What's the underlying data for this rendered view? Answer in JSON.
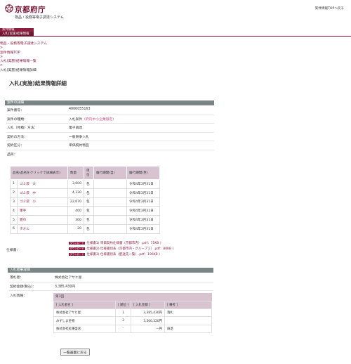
{
  "header": {
    "logo_text": "京都府庁",
    "subtitle": "物品・役務等電子調達システム",
    "back_to_top": "案件情報TOPへ戻る"
  },
  "menu": {
    "tabs": [
      "案件情報",
      "入札(実施)結果情報"
    ]
  },
  "breadcrumb": {
    "items": [
      "物品・役務等電子調達システム",
      "案件情報TOP",
      "入札(実施)結果情報一覧"
    ],
    "separator": ">",
    "current": "入札(実施)結果情報詳細"
  },
  "page_title": "入札(実施)結果情報詳細",
  "case": {
    "section_title": "案件の詳細",
    "rows": [
      {
        "label": "案件番号：",
        "value": "4000055163"
      },
      {
        "label": "案件の種類：",
        "value": "入札案件",
        "note": "(府内中小企業限定)"
      },
      {
        "label": "入札（見積）方法：",
        "value": "電子調達"
      },
      {
        "label": "契約の方法：",
        "value": "一般競争入札"
      },
      {
        "label": "契約区分：",
        "value": "単価契約物品"
      },
      {
        "label": "品目：",
        "value": ""
      }
    ]
  },
  "items_table": {
    "headers": [
      "品名(品名をクリックで詳細表示)",
      "数量",
      "単位",
      "履行期間(自)",
      "履行期間(至)"
    ],
    "rows": [
      {
        "no": "1",
        "name": "ゴミ袋　大",
        "qty": "3,600",
        "unit": "包",
        "from": "",
        "to": "令和4年3月31日"
      },
      {
        "no": "2",
        "name": "ゴミ袋　中",
        "qty": "4,330",
        "unit": "包",
        "from": "",
        "to": "令和4年3月31日"
      },
      {
        "no": "3",
        "name": "ゴミ袋　小",
        "qty": "22,670",
        "unit": "包",
        "from": "",
        "to": "令和4年3月31日"
      },
      {
        "no": "4",
        "name": "軍手",
        "qty": "400",
        "unit": "包",
        "from": "",
        "to": "令和4年3月31日"
      },
      {
        "no": "5",
        "name": "雑巾",
        "qty": "300",
        "unit": "包",
        "from": "",
        "to": "令和4年3月31日"
      },
      {
        "no": "6",
        "name": "タオル",
        "qty": "20",
        "unit": "包",
        "from": "",
        "to": "令和4年3月31日"
      }
    ]
  },
  "specs": {
    "label": "仕様書：",
    "badge": "ダウンロード",
    "files": [
      "仕様書1( 単価契約仕様書（京都市内）.pdf：75KB )",
      "仕様書2( 仕様書別表（京都市内・グループ２）.pdf：80KB )",
      "仕様書3( 仕様書別表（配送先一覧）.pdf：196KB )"
    ]
  },
  "result": {
    "section_title": "入札結果詳細",
    "winner_label": "落札者：",
    "winner_value": "株式会社アサヒ屋",
    "amount_label": "契約金額(税込)：",
    "amount_value": "3,385,430円",
    "bid_info_label": "入札情報：",
    "round_title": "第1回",
    "bid_headers": [
      "[ 入札者名 ]",
      "[ 順位 ]",
      "[ 入札金額 ]",
      "[ 備考 ]"
    ],
    "bids": [
      {
        "name": "株式会社アサヒ屋",
        "rank": "1",
        "amount": "3,385,430円",
        "note": "落札"
      },
      {
        "name": "みずしま金物",
        "rank": "2",
        "amount": "3,500,320円",
        "note": ""
      },
      {
        "name": "株式会社紅蓮盛店",
        "rank": "-",
        "amount": "－円",
        "note": "辞退"
      }
    ]
  },
  "footer": {
    "back_button": "一覧画面に戻る"
  },
  "colors": {
    "brand": "#8b1d3f",
    "header_bar": "#7a8585",
    "table_header": "#d8c4d1",
    "link_pink": "#d24b86"
  }
}
